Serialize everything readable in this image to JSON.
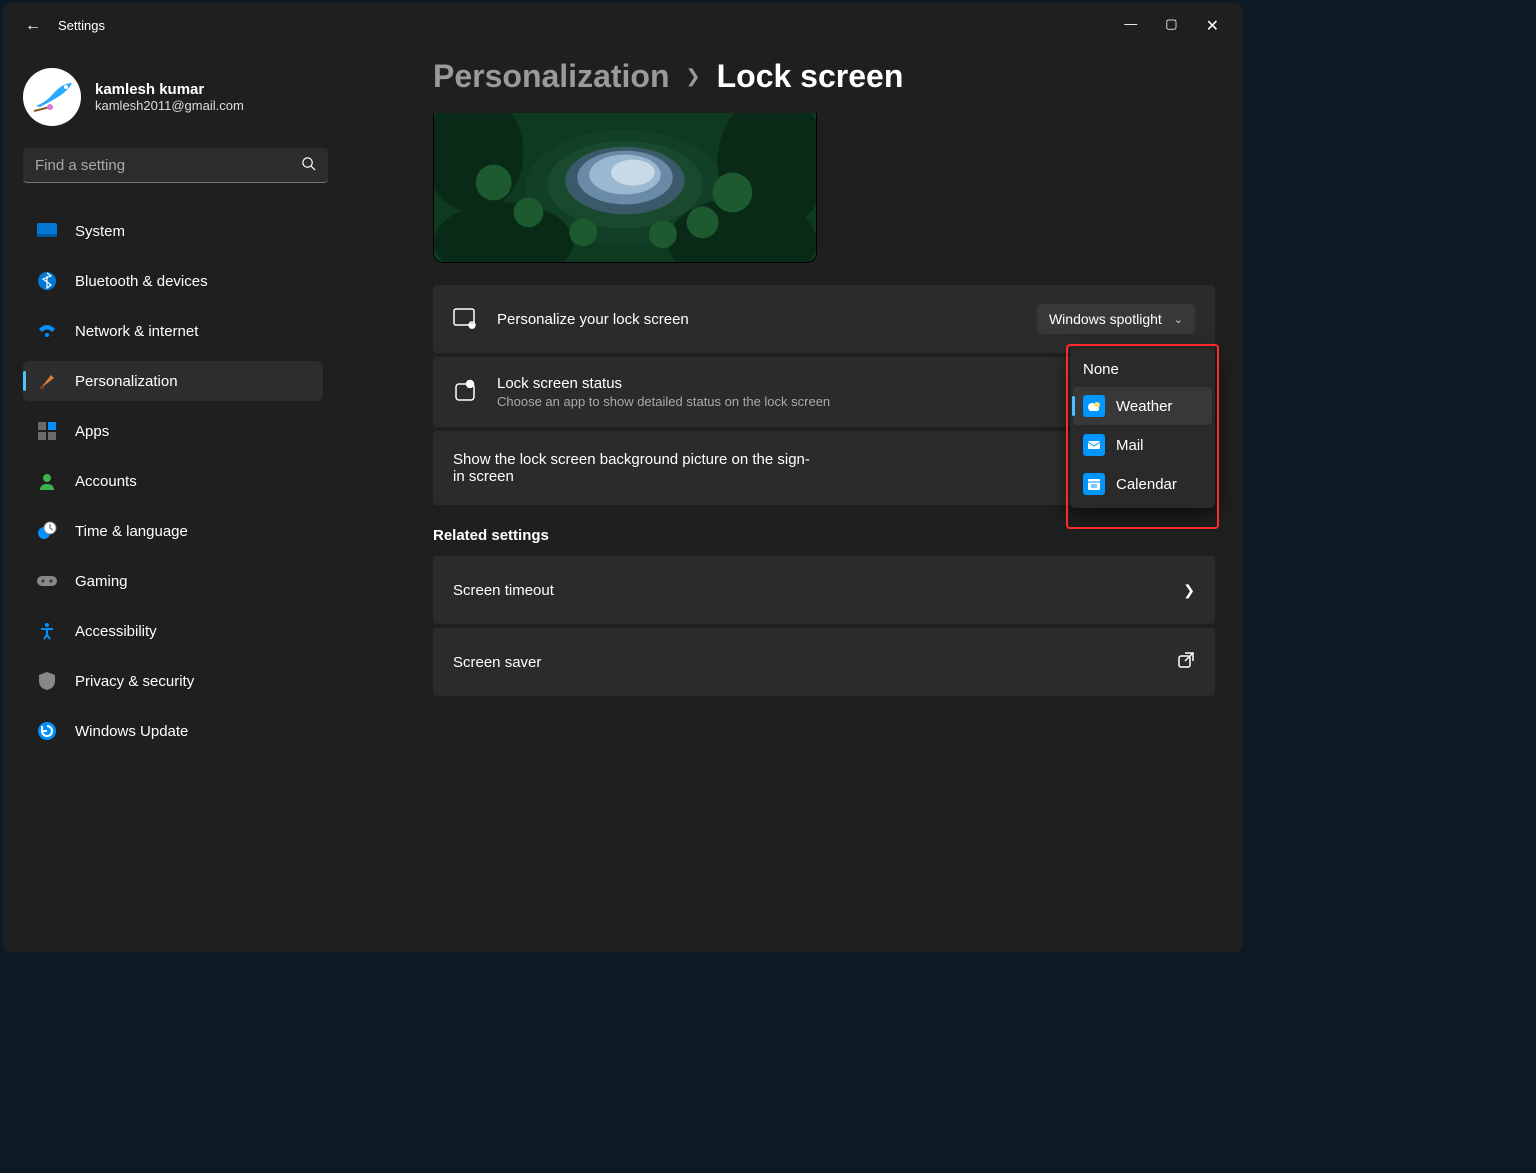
{
  "window": {
    "title": "Settings"
  },
  "profile": {
    "name": "kamlesh kumar",
    "email": "kamlesh2011@gmail.com"
  },
  "search": {
    "placeholder": "Find a setting"
  },
  "sidebar": {
    "items": [
      {
        "label": "System"
      },
      {
        "label": "Bluetooth & devices"
      },
      {
        "label": "Network & internet"
      },
      {
        "label": "Personalization"
      },
      {
        "label": "Apps"
      },
      {
        "label": "Accounts"
      },
      {
        "label": "Time & language"
      },
      {
        "label": "Gaming"
      },
      {
        "label": "Accessibility"
      },
      {
        "label": "Privacy & security"
      },
      {
        "label": "Windows Update"
      }
    ]
  },
  "breadcrumb": {
    "parent": "Personalization",
    "current": "Lock screen"
  },
  "cards": {
    "personalize": {
      "title": "Personalize your lock screen",
      "value": "Windows spotlight"
    },
    "status": {
      "title": "Lock screen status",
      "sub": "Choose an app to show detailed status on the lock screen"
    },
    "signin": {
      "title": "Show the lock screen background picture on the sign-in screen"
    },
    "related_title": "Related settings",
    "timeout": {
      "title": "Screen timeout"
    },
    "saver": {
      "title": "Screen saver"
    }
  },
  "popup": {
    "items": [
      {
        "label": "None"
      },
      {
        "label": "Weather"
      },
      {
        "label": "Mail"
      },
      {
        "label": "Calendar"
      }
    ]
  }
}
